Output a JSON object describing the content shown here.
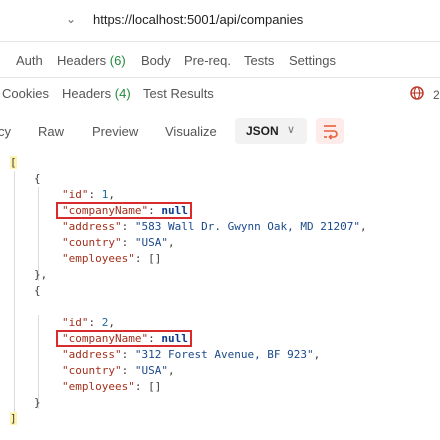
{
  "url_bar": {
    "url": "https://localhost:5001/api/companies",
    "chevron": "⌄"
  },
  "request_tabs": [
    {
      "label": "Auth"
    },
    {
      "label": "Headers",
      "count": "(6)"
    },
    {
      "label": "Body"
    },
    {
      "label": "Pre-req."
    },
    {
      "label": "Tests"
    },
    {
      "label": "Settings"
    }
  ],
  "response_tabs": [
    {
      "label": "Cookies"
    },
    {
      "label": "Headers",
      "count": "(4)"
    },
    {
      "label": "Test Results"
    }
  ],
  "status": {
    "icon": "globe-alert-icon",
    "partial_text": "2"
  },
  "view_tabs": {
    "cut_label": "cy",
    "raw": "Raw",
    "preview": "Preview",
    "visualize": "Visualize"
  },
  "format_select": {
    "value": "JSON"
  },
  "wrap_icon": "wrap-lines-icon",
  "colors": {
    "key": "#a3301d",
    "string": "#1a4a8a",
    "highlight_box": "#d92b2b",
    "count": "#1f8a3a"
  },
  "json": {
    "open_array": "[",
    "close_array": "]",
    "open_obj": "{",
    "close_obj_comma": "},",
    "close_obj": "}",
    "records": [
      {
        "id_key": "\"id\"",
        "id_val": "1",
        "company_key": "\"companyName\"",
        "company_val": "null",
        "address_key": "\"address\"",
        "address_val": "\"583 Wall Dr. Gwynn Oak, MD 21207\"",
        "country_key": "\"country\"",
        "country_val": "\"USA\"",
        "employees_key": "\"employees\"",
        "employees_val": "[]"
      },
      {
        "id_key": "\"id\"",
        "id_val": "2",
        "company_key": "\"companyName\"",
        "company_val": "null",
        "address_key": "\"address\"",
        "address_val": "\"312 Forest Avenue, BF 923\"",
        "country_key": "\"country\"",
        "country_val": "\"USA\"",
        "employees_key": "\"employees\"",
        "employees_val": "[]"
      }
    ]
  }
}
